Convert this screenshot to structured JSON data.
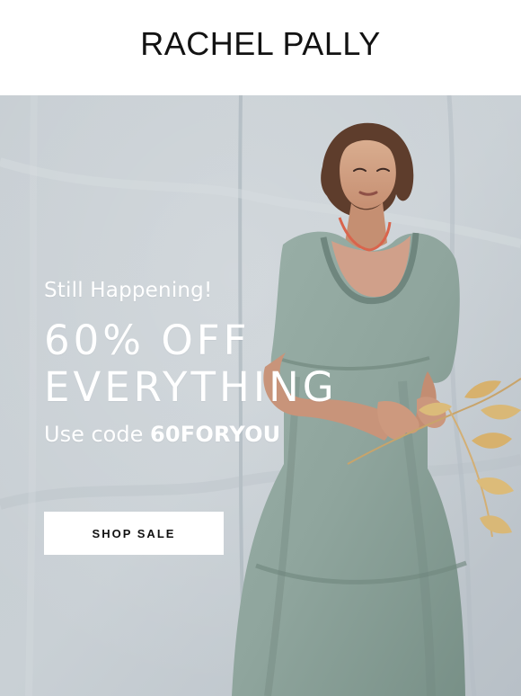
{
  "brand": {
    "name": "RACHEL PALLY"
  },
  "hero": {
    "eyebrow": "Still Happening!",
    "headline_line_1": "60% OFF",
    "headline_line_2": "EVERYTHING",
    "promo_prefix": "Use code",
    "promo_code": "60FORYOU",
    "cta_label": "SHOP SALE"
  },
  "colors": {
    "header_background": "#ffffff",
    "brand_text": "#121212",
    "hero_backdrop": "#c4cbd1",
    "dress": "#8fa59d",
    "copy_text": "#ffffff",
    "cta_background": "#ffffff",
    "cta_text": "#111111",
    "necklace": "#d9644c",
    "foliage": "#d7b16d"
  }
}
